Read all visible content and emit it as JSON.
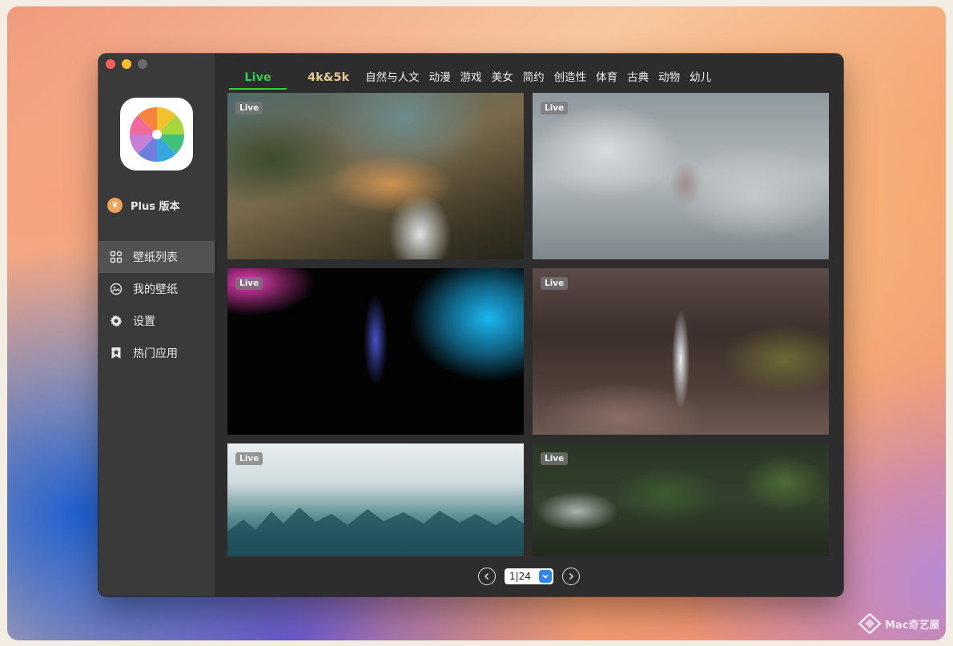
{
  "sidebar": {
    "plus_label": "Plus 版本",
    "plus_icon": "crown-icon",
    "items": [
      {
        "label": "壁纸列表",
        "icon": "grid-icon",
        "active": true
      },
      {
        "label": "我的壁纸",
        "icon": "picture-icon",
        "active": false
      },
      {
        "label": "设置",
        "icon": "gear-icon",
        "active": false
      },
      {
        "label": "热门应用",
        "icon": "bookmark-star-icon",
        "active": false
      }
    ]
  },
  "tabs": [
    "Live",
    "4k&5k",
    "自然与人文",
    "动漫",
    "游戏",
    "美女",
    "简约",
    "创造性",
    "体育",
    "古典",
    "动物",
    "幼儿"
  ],
  "active_tab": "Live",
  "wallpapers": [
    {
      "badge": "Live"
    },
    {
      "badge": "Live"
    },
    {
      "badge": "Live"
    },
    {
      "badge": "Live"
    },
    {
      "badge": "Live"
    },
    {
      "badge": "Live"
    }
  ],
  "pager": {
    "current": "1|24"
  },
  "watermark": {
    "text": "Mac奇艺屋"
  },
  "colors": {
    "accent_green": "#2fd13f",
    "tab_gold": "#e6c891",
    "select_blue": "#2f86f0",
    "plus_orange": "#f2a35b"
  }
}
